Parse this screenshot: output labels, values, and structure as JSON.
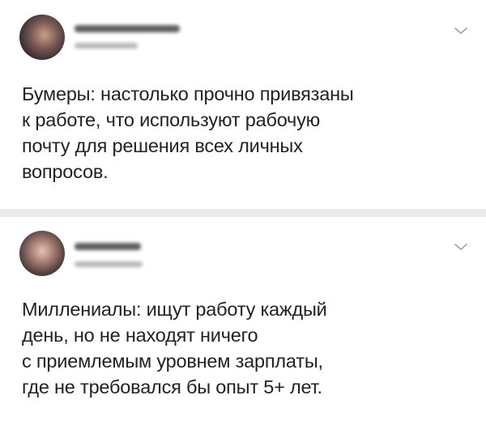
{
  "posts": [
    {
      "text": "Бумеры: настолько прочно привязаны\nк работе, что используют рабочую\nпочту для решения всех личных\nвопросов."
    },
    {
      "text": "Миллениалы: ищут работу каждый\nдень, но не находят ничего\nс приемлемым уровнем зарплаты,\nгде не требовался бы опыт 5+ лет."
    }
  ],
  "icons": {
    "menu": "chevron-down-icon"
  },
  "colors": {
    "background": "#ffffff",
    "separator": "#e9ebee",
    "text": "#222222",
    "chevron": "#9aa0a6"
  }
}
